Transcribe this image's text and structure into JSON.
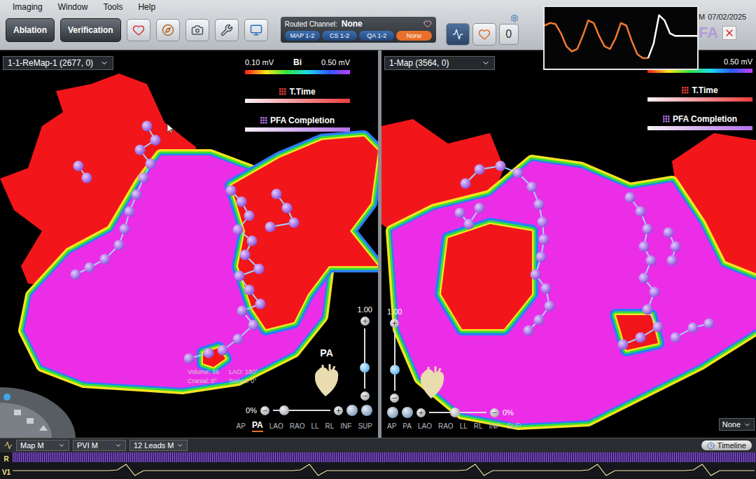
{
  "menu": [
    "Imaging",
    "Window",
    "Tools",
    "Help"
  ],
  "toolbar": {
    "buttons": [
      {
        "label": "Ablation"
      },
      {
        "label": "Verification"
      }
    ]
  },
  "routed_channel": {
    "label": "Routed Channel:",
    "value": "None",
    "buttons": [
      {
        "label": "MAP 1-2",
        "selected": false
      },
      {
        "label": "CS 1-2",
        "selected": false
      },
      {
        "label": "QA 1-2",
        "selected": false
      },
      {
        "label": "None",
        "selected": true
      }
    ]
  },
  "counter": "0",
  "status": {
    "time": "M",
    "date": "07/02/2025",
    "badge": "FA"
  },
  "waveform": {
    "series": [
      {
        "color": "#f07a32",
        "values": [
          0.75,
          0.8,
          0.78,
          0.6,
          0.35,
          0.25,
          0.3,
          0.55,
          0.85,
          0.8,
          0.55,
          0.35,
          0.3,
          0.5,
          0.8,
          0.75,
          0.45,
          0.2,
          0.12,
          0.12
        ]
      },
      {
        "color": "#ffffff",
        "values": [
          0.12,
          0.4,
          0.95,
          0.85,
          0.6,
          0.55,
          0.55,
          0.55,
          0.55,
          0.55
        ]
      }
    ]
  },
  "maps": [
    {
      "title": "1-1-ReMap-1 (2677, 0)",
      "legend": {
        "min": "0.10 mV",
        "label": "Bi",
        "max": "0.50 mV"
      },
      "layers": [
        {
          "label": "T.Time",
          "color": "#ef3b3b"
        },
        {
          "label": "PFA Completion",
          "color": "#b36ee8"
        }
      ],
      "orientation": [
        "Volume: 46",
        "LAO: 180°",
        "Cranial: 0°",
        "Swivel: 0°"
      ],
      "view_label": "PA",
      "zoom": "1.00",
      "zoom_level": 0.35,
      "opacity": "0%",
      "opacity_level": 0.2,
      "views": [
        {
          "label": "AP",
          "selected": false
        },
        {
          "label": "PA",
          "selected": true
        },
        {
          "label": "LAO",
          "selected": false
        },
        {
          "label": "RAO",
          "selected": false
        },
        {
          "label": "LL",
          "selected": false
        },
        {
          "label": "RL",
          "selected": false
        },
        {
          "label": "INF",
          "selected": false
        },
        {
          "label": "SUP",
          "selected": false
        }
      ]
    },
    {
      "title": "1-Map (3564, 0)",
      "legend": {
        "max": "0.50 mV"
      },
      "layers": [
        {
          "label": "T.Time",
          "color": "#ef3b3b"
        },
        {
          "label": "PFA Completion",
          "color": "#b36ee8"
        }
      ],
      "zoom": "1.00",
      "zoom_level": 0.35,
      "opacity": "0%",
      "opacity_level": 0.45,
      "views": [
        {
          "label": "AP",
          "selected": false
        },
        {
          "label": "PA",
          "selected": false
        },
        {
          "label": "LAO",
          "selected": false
        },
        {
          "label": "RAO",
          "selected": false
        },
        {
          "label": "LL",
          "selected": false
        },
        {
          "label": "RL",
          "selected": false
        },
        {
          "label": "INF",
          "selected": false
        },
        {
          "label": "SUP",
          "selected": false
        }
      ],
      "selector": "None"
    }
  ],
  "bottom_bar": {
    "dropdowns": [
      "Map M",
      "PVI M",
      "12 Leads M"
    ],
    "timeline": "Timeline"
  },
  "ecg": {
    "leads": [
      {
        "label": "R",
        "color": "#8b55e0"
      },
      {
        "label": "V1",
        "color": "#f3e6a8",
        "values": [
          0.5,
          0.5,
          0.5,
          0.5,
          0.5,
          0.5,
          0.5,
          0.5,
          0.5,
          0.5,
          0.5,
          0.5,
          0.55,
          0.95,
          0.15,
          0.5,
          0.5,
          0.5,
          0.5,
          0.5,
          0.5,
          0.5,
          0.5,
          0.5,
          0.5,
          0.5,
          0.5,
          0.5,
          0.5,
          0.5,
          0.5,
          0.5,
          0.5,
          0.55,
          0.95,
          0.15,
          0.5,
          0.5,
          0.5,
          0.5,
          0.5,
          0.5,
          0.5,
          0.5,
          0.5,
          0.5,
          0.5,
          0.5,
          0.5,
          0.5,
          0.5,
          0.5,
          0.55,
          0.95,
          0.15,
          0.5,
          0.5,
          0.5,
          0.5,
          0.5,
          0.5,
          0.5,
          0.5,
          0.5,
          0.5,
          0.5,
          0.55,
          0.95,
          0.15,
          0.5,
          0.5,
          0.5,
          0.5,
          0.5,
          0.5,
          0.5,
          0.5,
          0.5,
          0.55,
          0.95,
          0.15,
          0.5,
          0.5,
          0.5,
          0.5,
          0.5
        ]
      }
    ]
  }
}
